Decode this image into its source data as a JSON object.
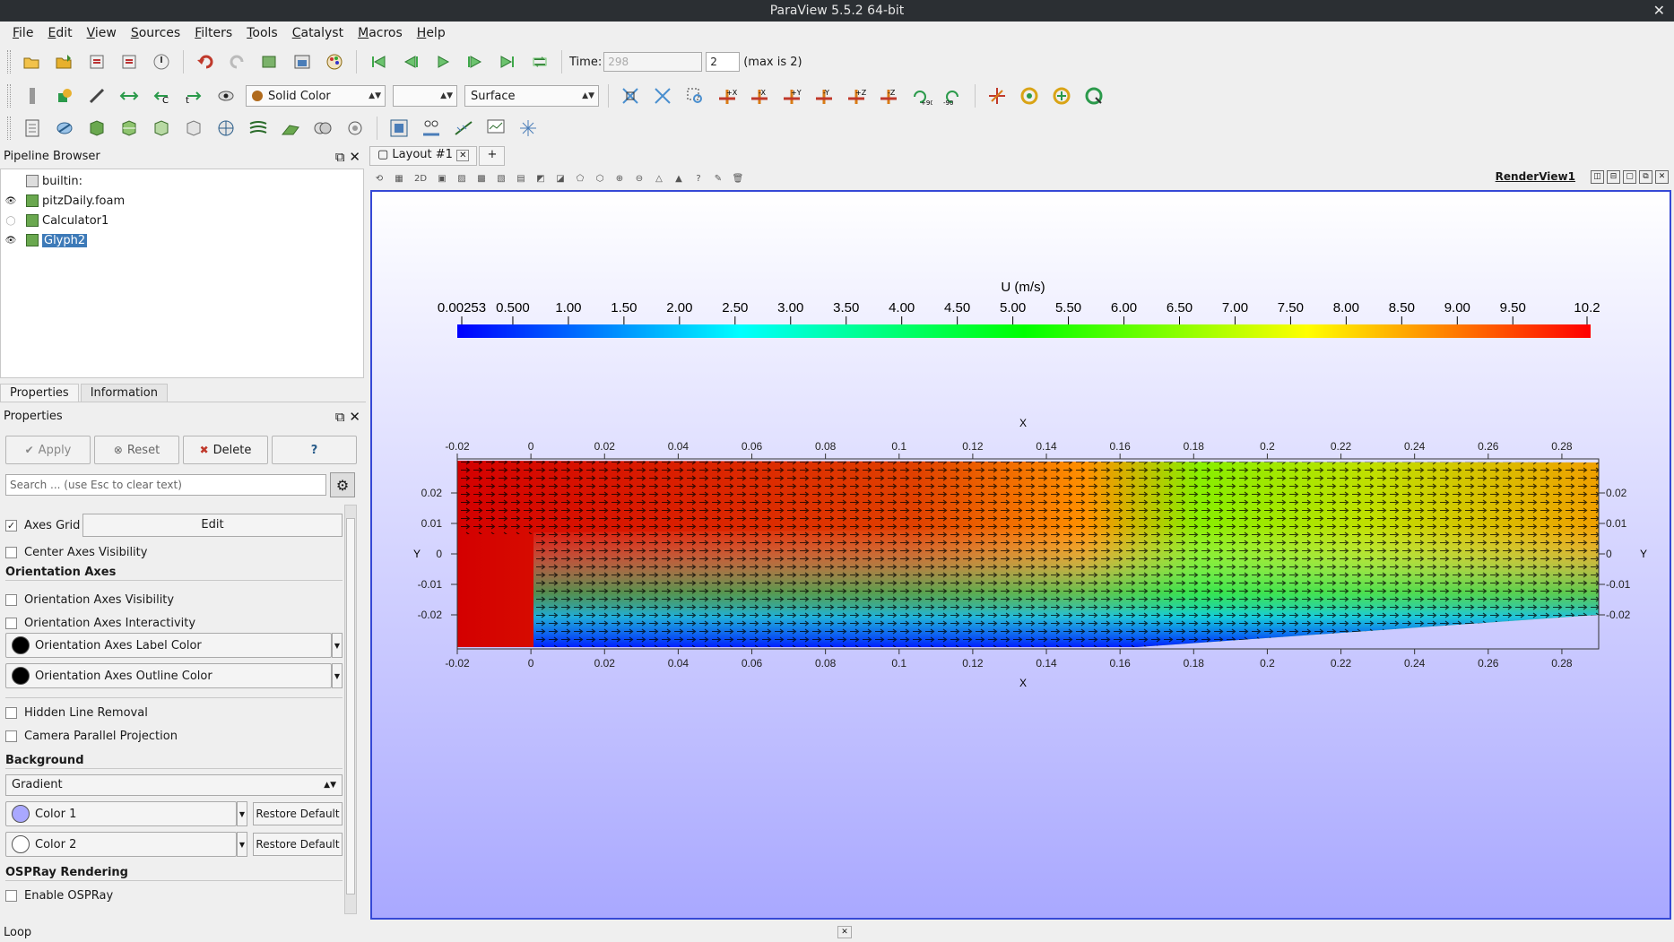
{
  "window": {
    "title": "ParaView 5.5.2 64-bit",
    "close_glyph": "✕"
  },
  "menu": [
    "File",
    "Edit",
    "View",
    "Sources",
    "Filters",
    "Tools",
    "Catalyst",
    "Macros",
    "Help"
  ],
  "toolbar": {
    "time_label": "Time:",
    "time_value": "298",
    "timestep": "2",
    "max_label": "(max is 2)",
    "color_by": "Solid Color",
    "representation": "Surface"
  },
  "pipeline": {
    "title": "Pipeline Browser",
    "items": [
      {
        "label": "builtin:",
        "icon": "server-icon",
        "eye": ""
      },
      {
        "label": "pitzDaily.foam",
        "icon": "reader-icon",
        "eye": "visible"
      },
      {
        "label": "Calculator1",
        "icon": "filter-icon",
        "eye": "hidden"
      },
      {
        "label": "Glyph2",
        "icon": "filter-icon",
        "eye": "visible",
        "selected": true
      }
    ]
  },
  "properties": {
    "tabs": [
      "Properties",
      "Information"
    ],
    "title": "Properties",
    "apply": "Apply",
    "reset": "Reset",
    "delete": "Delete",
    "help": "?",
    "search_placeholder": "Search ... (use Esc to clear text)",
    "axes_grid_label": "Axes Grid",
    "axes_grid_checked": true,
    "edit_label": "Edit",
    "center_axes": "Center Axes Visibility",
    "orientation_section": "Orientation Axes",
    "orientation_visibility": "Orientation Axes Visibility",
    "orientation_interactivity": "Orientation Axes Interactivity",
    "orientation_label_color": "Orientation Axes Label Color",
    "orientation_outline_color": "Orientation Axes Outline Color",
    "hidden_line": "Hidden Line Removal",
    "camera_parallel": "Camera Parallel Projection",
    "background_section": "Background",
    "background_mode": "Gradient",
    "color1": "Color 1",
    "color2": "Color 2",
    "restore_default": "Restore Default",
    "ospray_section": "OSPRay Rendering",
    "enable_ospray": "Enable OSPRay",
    "color1_hex": "#a9a8ff",
    "color2_hex": "#ffffff"
  },
  "layout": {
    "tab": "Layout #1",
    "add_tab": "+",
    "view_name": "RenderView1",
    "mode_2d": "2D"
  },
  "scalar_bar": {
    "title": "U (m/s)",
    "labels": [
      "0.00253",
      "0.500",
      "1.00",
      "1.50",
      "2.00",
      "2.50",
      "3.00",
      "3.50",
      "4.00",
      "4.50",
      "5.00",
      "5.50",
      "6.00",
      "6.50",
      "7.00",
      "7.50",
      "8.00",
      "8.50",
      "9.00",
      "9.50",
      "10.2"
    ]
  },
  "axes_grid": {
    "x_title": "X",
    "y_title": "Y",
    "x_ticks": [
      "-0.02",
      "0",
      "0.02",
      "0.04",
      "0.06",
      "0.08",
      "0.1",
      "0.12",
      "0.14",
      "0.16",
      "0.18",
      "0.2",
      "0.22",
      "0.24",
      "0.26",
      "0.28"
    ],
    "y_ticks": [
      "0.02",
      "0.01",
      "0",
      "-0.01",
      "-0.02"
    ]
  },
  "status": {
    "text": "Loop"
  }
}
